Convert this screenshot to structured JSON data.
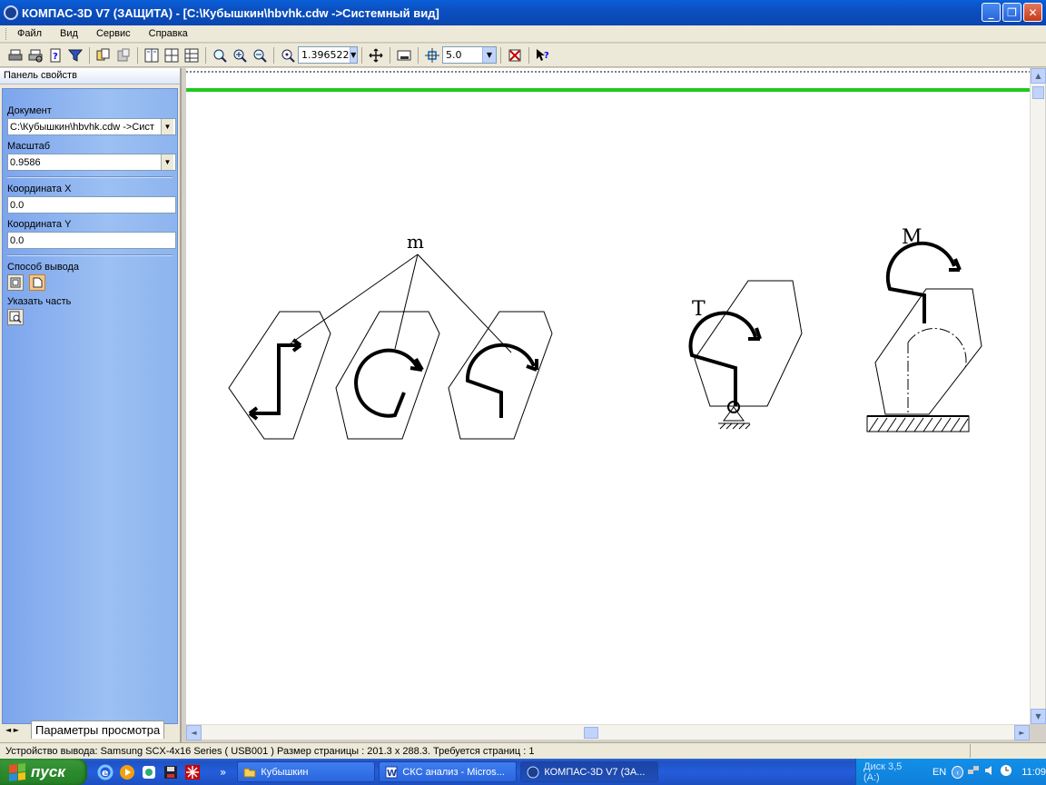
{
  "window": {
    "title": "КОМПАС-3D V7 (ЗАЩИТА) - [C:\\Кубышкин\\hbvhk.cdw ->Системный вид]",
    "buttons": {
      "minimize": "_",
      "restore": "❐",
      "close": "✕"
    }
  },
  "menu": [
    "Файл",
    "Вид",
    "Сервис",
    "Справка"
  ],
  "toolbar": {
    "zoom_value": "1.396522",
    "step_value": "5.0"
  },
  "left_panel": {
    "title": "Панель свойств",
    "document_label": "Документ",
    "document_value": "C:\\Кубышкин\\hbvhk.cdw ->Сист",
    "scale_label": "Масштаб",
    "scale_value": "0.9586",
    "coord_x_label": "Координата X",
    "coord_x_value": "0.0",
    "coord_y_label": "Координата Y",
    "coord_y_value": "0.0",
    "output_label": "Способ вывода",
    "part_label": "Указать часть",
    "tab_label": "Параметры просмотра",
    "tab_nav": "◄ ►"
  },
  "drawing": {
    "label_m": "m",
    "label_T": "T",
    "label_M": "M"
  },
  "status": {
    "text": "Устройство вывода: Samsung SCX-4x16 Series ( USB001 )  Размер страницы : 201.3 x 288.3.  Требуется страниц : 1"
  },
  "taskbar": {
    "start": "пуск",
    "overflow": "»",
    "tasks": [
      {
        "label": "Кубышкин",
        "active": false
      },
      {
        "label": "СКС анализ - Micros...",
        "active": false
      },
      {
        "label": "КОМПАС-3D V7 (ЗА...",
        "active": true
      }
    ],
    "tray_disk": "Диск 3,5 (A:)",
    "tray_lang": "EN",
    "tray_time": "11:09"
  }
}
